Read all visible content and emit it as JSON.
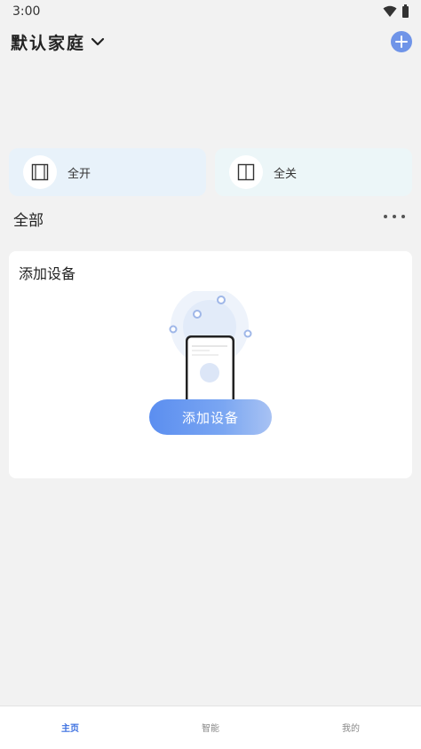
{
  "status_bar": {
    "time": "3:00"
  },
  "header": {
    "home_name": "默认家庭"
  },
  "scenes": [
    {
      "label": "全开"
    },
    {
      "label": "全关"
    }
  ],
  "section": {
    "title": "全部"
  },
  "device_card": {
    "title": "添加设备",
    "button_label": "添加设备"
  },
  "tab_bar": {
    "tabs": [
      {
        "label": "主页",
        "active": true
      },
      {
        "label": "智能",
        "active": false
      },
      {
        "label": "我的",
        "active": false
      }
    ]
  },
  "colors": {
    "accent": "#3b6fe0",
    "add_button": "#6f94e8",
    "scene_open_bg": "#e8f2fa",
    "scene_close_bg": "#ecf6f8"
  }
}
